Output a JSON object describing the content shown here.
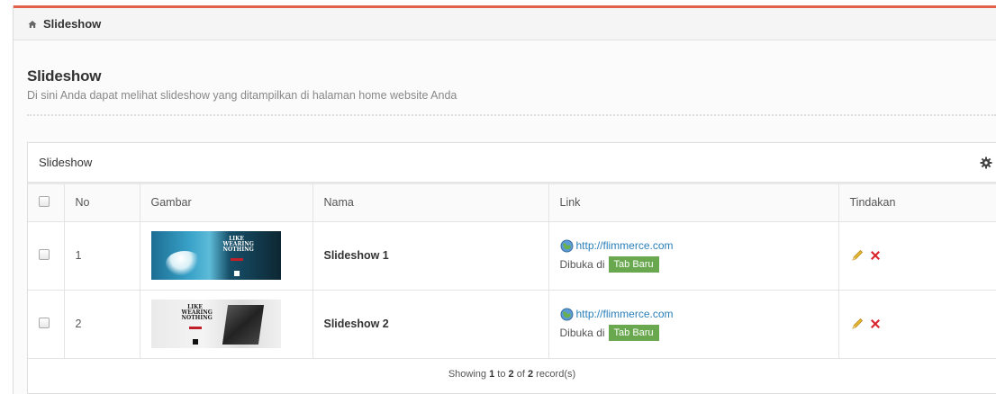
{
  "breadcrumb": {
    "icon": "home-icon",
    "label": "Slideshow"
  },
  "page": {
    "title": "Slideshow",
    "subtitle": "Di sini Anda dapat melihat slideshow yang ditampilkan di halaman home website Anda"
  },
  "panel": {
    "title": "Slideshow",
    "settings_icon": "gear-icon"
  },
  "table": {
    "columns": [
      "No",
      "Gambar",
      "Nama",
      "Link",
      "Tindakan"
    ],
    "rows": [
      {
        "no": "1",
        "image": "Slideshow 1 thumbnail",
        "thumb_text": "LIKE WEARING NOTHING",
        "name": "Slideshow 1",
        "link": "http://flimmerce.com",
        "opened_label": "Dibuka di",
        "opened_badge": "Tab Baru"
      },
      {
        "no": "2",
        "image": "Slideshow 2 thumbnail",
        "thumb_text": "LIKE WEARING NOTHING",
        "name": "Slideshow 2",
        "link": "http://flimmerce.com",
        "opened_label": "Dibuka di",
        "opened_badge": "Tab Baru"
      }
    ]
  },
  "footer": {
    "prefix": "Showing",
    "from": "1",
    "to_word": "to",
    "to": "2",
    "of_word": "of",
    "total": "2",
    "suffix": "record(s)"
  },
  "colors": {
    "accent": "#e2624b",
    "badge": "#6aa84f",
    "link": "#2a7fb8",
    "delete": "#d9232d",
    "edit": "#e8b92e"
  }
}
